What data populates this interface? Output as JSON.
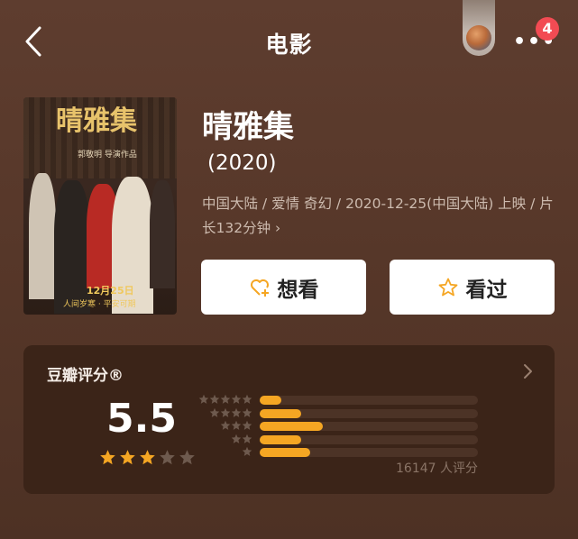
{
  "header": {
    "title": "电影",
    "notification_count": "4",
    "more_label": "•••"
  },
  "poster": {
    "title_art": "晴雅集",
    "subtitle_art": "郭敬明 导演作品",
    "date_art": "12月25日",
    "slogan_art": "人间岁寒 · 平安可期"
  },
  "movie": {
    "title": "晴雅集",
    "year": "(2020)",
    "meta": "中国大陆 / 爱情 奇幻 / 2020-12-25(中国大陆) 上映 / 片长132分钟 ›"
  },
  "actions": {
    "want_label": "想看",
    "seen_label": "看过"
  },
  "rating": {
    "label": "豆瓣评分®",
    "score": "5.5",
    "stars_filled": 3,
    "stars_total": 5,
    "distribution": [
      {
        "stars": 5,
        "fraction": 0.1
      },
      {
        "stars": 4,
        "fraction": 0.19
      },
      {
        "stars": 3,
        "fraction": 0.29
      },
      {
        "stars": 2,
        "fraction": 0.19
      },
      {
        "stars": 1,
        "fraction": 0.23
      }
    ],
    "votes": "16147 人评分"
  },
  "colors": {
    "background": "#5a3a2c",
    "card": "#3b2418",
    "accent_star": "#f5a623",
    "badge": "#f24b53"
  }
}
